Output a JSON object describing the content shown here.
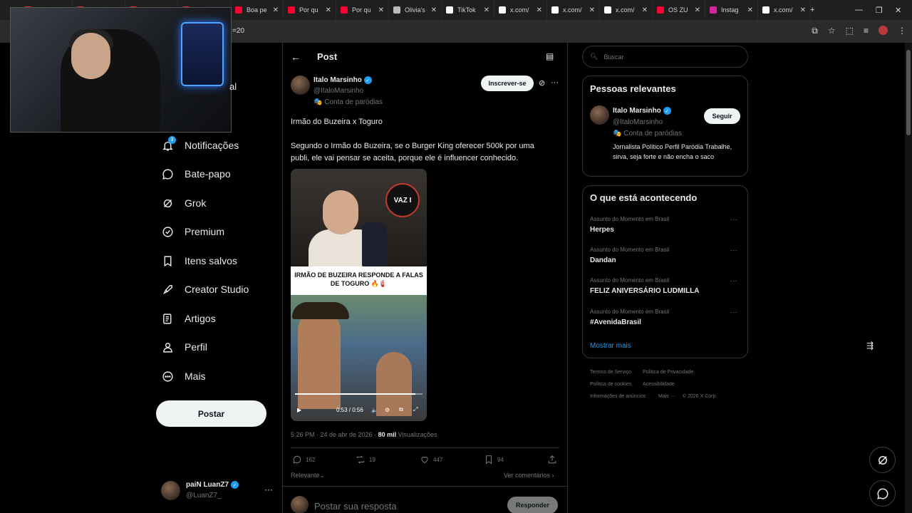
{
  "browser": {
    "tabs": [
      {
        "label": "",
        "color": "#e03030"
      },
      {
        "label": "",
        "color": "#e03030"
      },
      {
        "label": "",
        "color": "#e03030"
      },
      {
        "label": "",
        "color": "#e03030"
      },
      {
        "label": "Boa pe",
        "color": "#ff0033"
      },
      {
        "label": "Por qu",
        "color": "#ff0033"
      },
      {
        "label": "Por qu",
        "color": "#ff0033"
      },
      {
        "label": "Olivia's",
        "color": "#bbbbbb"
      },
      {
        "label": "TikTok",
        "color": "#ffffff"
      },
      {
        "label": "x.com/",
        "color": "#ffffff"
      },
      {
        "label": "x.com/",
        "color": "#ffffff"
      },
      {
        "label": "x.com/",
        "color": "#ffffff"
      },
      {
        "label": "OS ZU",
        "color": "#ff0033"
      },
      {
        "label": "Instag",
        "color": "#d6249f"
      },
      {
        "label": "x.com/",
        "color": "#ffffff"
      }
    ],
    "new_tab": "+",
    "url_fragment": "=20"
  },
  "webcam_overlay_text": "al",
  "nav": {
    "items": [
      {
        "label": "Notificações",
        "icon": "bell-icon"
      },
      {
        "label": "Bate-papo",
        "icon": "chat-icon"
      },
      {
        "label": "Grok",
        "icon": "grok-icon"
      },
      {
        "label": "Premium",
        "icon": "premium-icon"
      },
      {
        "label": "Itens salvos",
        "icon": "bookmark-icon"
      },
      {
        "label": "Creator Studio",
        "icon": "rocket-icon"
      },
      {
        "label": "Artigos",
        "icon": "article-icon"
      },
      {
        "label": "Perfil",
        "icon": "person-icon"
      },
      {
        "label": "Mais",
        "icon": "more-circle-icon"
      }
    ],
    "notification_count": "3",
    "post_button": "Postar"
  },
  "account": {
    "name": "paiN LuanZ7",
    "handle": "@LuanZ7_",
    "more": "···"
  },
  "post": {
    "header": "Post",
    "author_name": "Italo Marsinho",
    "author_handle": "@ItaloMarsinho",
    "author_label": "Conta de paródias",
    "subscribe_button": "Inscrever-se",
    "more": "···",
    "text_line1": "Irmão do Buzeira x Toguro",
    "text_body": "Segundo o Irmão do Buzeira, se o Burger King oferecer 500k por uma publi, ele vai pensar se aceita, porque ele é influencer conhecido.",
    "video": {
      "logo_text": "VAZ I",
      "caption": "IRMÃO DE BUZEIRA RESPONDE A FALAS DE TOGURO 🔥🧯",
      "time": "0:53 / 0:56",
      "progress": 0.946
    },
    "meta_time": "5:26 PM · 24 de abr de 2026 · ",
    "views_count": "80 mil",
    "views_label": " Visualizações",
    "replies": "162",
    "reposts": "19",
    "likes": "447",
    "bookmarks": "94",
    "sort_label": "Relevante",
    "view_comments": "Ver comentários",
    "reply_placeholder": "Postar sua resposta",
    "reply_button": "Responder"
  },
  "search": {
    "placeholder": "Buscar"
  },
  "relevant": {
    "title": "Pessoas relevantes",
    "name": "Italo Marsinho",
    "handle": "@ItaloMarsinho",
    "label": "Conta de paródias",
    "bio": "Jornalista Político Perfil Paródia Trabalhe, sirva, seja forte e não encha o saco",
    "follow_button": "Seguir"
  },
  "trends": {
    "title": "O que está acontecendo",
    "items": [
      {
        "category": "Assunto do Momento em Brasil",
        "name": "Herpes"
      },
      {
        "category": "Assunto do Momento em Brasil",
        "name": "Dandan"
      },
      {
        "category": "Assunto do Momento em Brasil",
        "name": "FELIZ ANIVERSÁRIO LUDMILLA"
      },
      {
        "category": "Assunto do Momento em Brasil",
        "name": "#AvenidaBrasil"
      }
    ],
    "show_more": "Mostrar mais"
  },
  "footer": {
    "links": [
      "Termos de Serviço",
      "Política de Privacidade",
      "Política de cookies",
      "Acessibilidade",
      "Informações de anúncios",
      "Mais ···",
      "© 2026 X Corp."
    ]
  },
  "colors": {
    "accent": "#1d9bf0",
    "background": "#000000",
    "border": "#2f3336",
    "muted": "#71767b"
  }
}
